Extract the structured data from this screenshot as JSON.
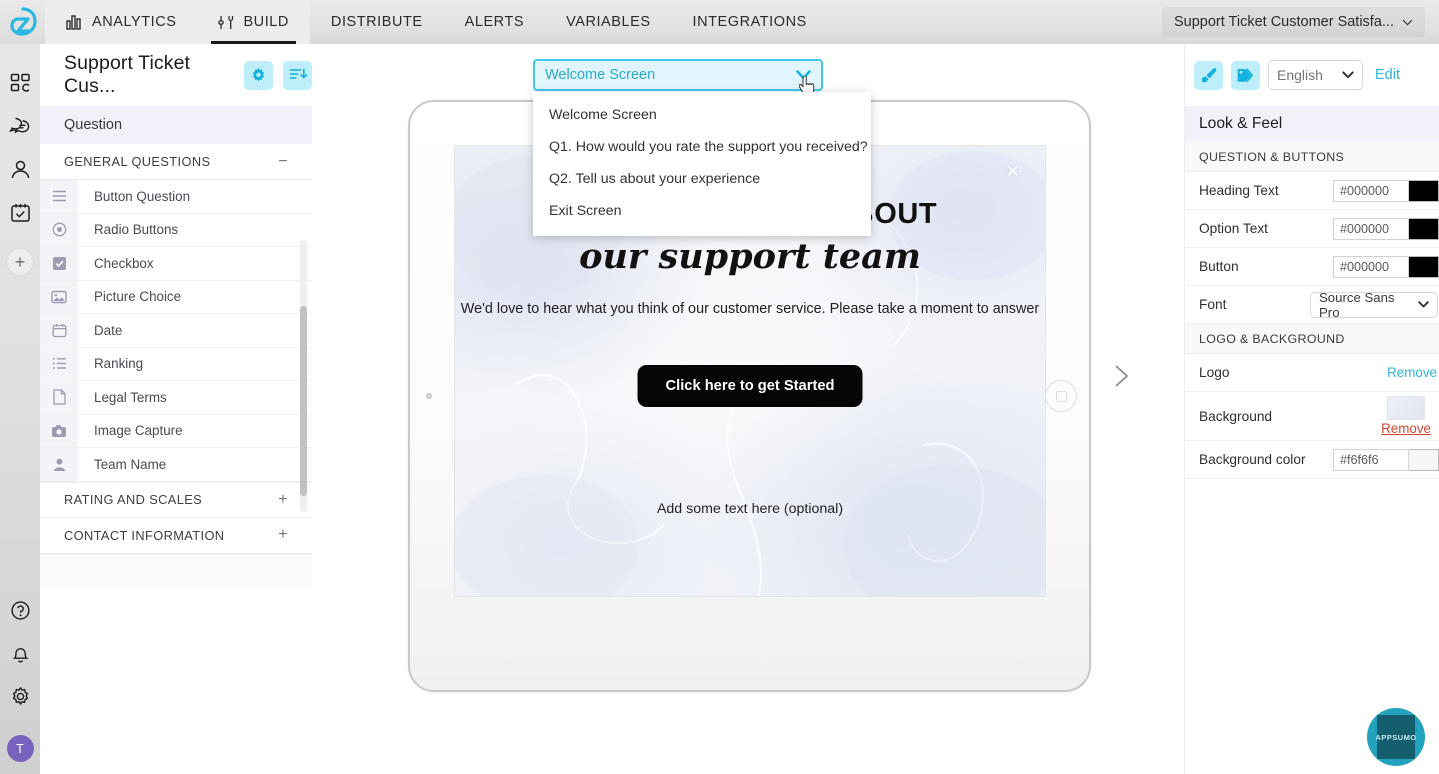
{
  "topnav": {
    "logo": "zonka-logo",
    "tabs": [
      {
        "label": "ANALYTICS",
        "icon": "bar-chart-icon",
        "active": false
      },
      {
        "label": "BUILD",
        "icon": "tools-icon",
        "active": true
      },
      {
        "label": "DISTRIBUTE",
        "icon": "",
        "active": false
      },
      {
        "label": "ALERTS",
        "icon": "",
        "active": false
      },
      {
        "label": "VARIABLES",
        "icon": "",
        "active": false
      },
      {
        "label": "INTEGRATIONS",
        "icon": "",
        "active": false
      }
    ],
    "project_selector": "Support Ticket Customer Satisfa...",
    "project_caret": "chevron-down-icon"
  },
  "rail": {
    "icons": [
      "grid-apps-icon",
      "feedback-chat-icon",
      "contacts-person-icon",
      "tasks-calendar-icon"
    ],
    "add_label": "+",
    "bottom_icons": [
      "help-circle-icon",
      "notification-bell-icon",
      "settings-gear-icon"
    ],
    "avatar_initial": "T"
  },
  "left_panel": {
    "survey_title": "Support Ticket Cus...",
    "settings_icon": "gear-icon",
    "logic_icon": "logic-flow-icon",
    "question_header": "Question",
    "groups": [
      {
        "label": "GENERAL QUESTIONS",
        "sign": "−",
        "expanded": true
      },
      {
        "label": "RATING AND SCALES",
        "sign": "+",
        "expanded": false
      },
      {
        "label": "CONTACT INFORMATION",
        "sign": "+",
        "expanded": false
      }
    ],
    "question_types": [
      {
        "label": "Button Question",
        "icon": "list-lines-icon"
      },
      {
        "label": "Radio Buttons",
        "icon": "radio-circle-icon"
      },
      {
        "label": "Checkbox",
        "icon": "checkbox-icon"
      },
      {
        "label": "Picture Choice",
        "icon": "image-icon"
      },
      {
        "label": "Date",
        "icon": "calendar-icon"
      },
      {
        "label": "Ranking",
        "icon": "ordered-list-icon"
      },
      {
        "label": "Legal Terms",
        "icon": "document-icon"
      },
      {
        "label": "Image Capture",
        "icon": "camera-icon"
      },
      {
        "label": "Team Name",
        "icon": "person-icon"
      }
    ]
  },
  "canvas": {
    "screen_select": {
      "value": "Welcome Screen",
      "caret": "chevron-down-icon",
      "options": [
        "Welcome Screen",
        "Q1. How would you rate the support you received?",
        "Q2. Tell us about your experience",
        "Exit Screen"
      ]
    },
    "preview": {
      "close_icon": "close-x-icon",
      "heading_line1": "YOUR FEEDBACK ABOUT",
      "heading_line2": "our support team",
      "subtext": "We'd love to hear what you think of our customer service. Please take a moment to answer",
      "cta_button": "Click here to get Started",
      "optional_text": "Add some text here (optional)"
    },
    "next_arrow": "chevron-right-icon"
  },
  "right_panel": {
    "brush_icon": "paintbrush-icon",
    "tag_icon": "tags-icon",
    "language": "English",
    "language_caret": "chevron-down-icon",
    "edit_label": "Edit",
    "title": "Look & Feel",
    "sections": [
      {
        "header": "QUESTION & BUTTONS",
        "rows": [
          {
            "label": "Heading Text",
            "value": "#000000",
            "swatch": "#000000",
            "type": "color"
          },
          {
            "label": "Option Text",
            "value": "#000000",
            "swatch": "#000000",
            "type": "color"
          },
          {
            "label": "Button",
            "value": "#000000",
            "swatch": "#000000",
            "type": "color"
          },
          {
            "label": "Font",
            "value": "Source Sans Pro",
            "type": "select"
          }
        ]
      },
      {
        "header": "LOGO & BACKGROUND",
        "rows": [
          {
            "label": "Logo",
            "action": "Remove",
            "type": "logo"
          },
          {
            "label": "Background",
            "action": "Remove",
            "type": "background"
          },
          {
            "label": "Background color",
            "value": "#f6f6f6",
            "swatch": "#f6f6f6",
            "type": "color"
          }
        ]
      }
    ]
  },
  "appsumo": {
    "label": "APPSUMO"
  }
}
